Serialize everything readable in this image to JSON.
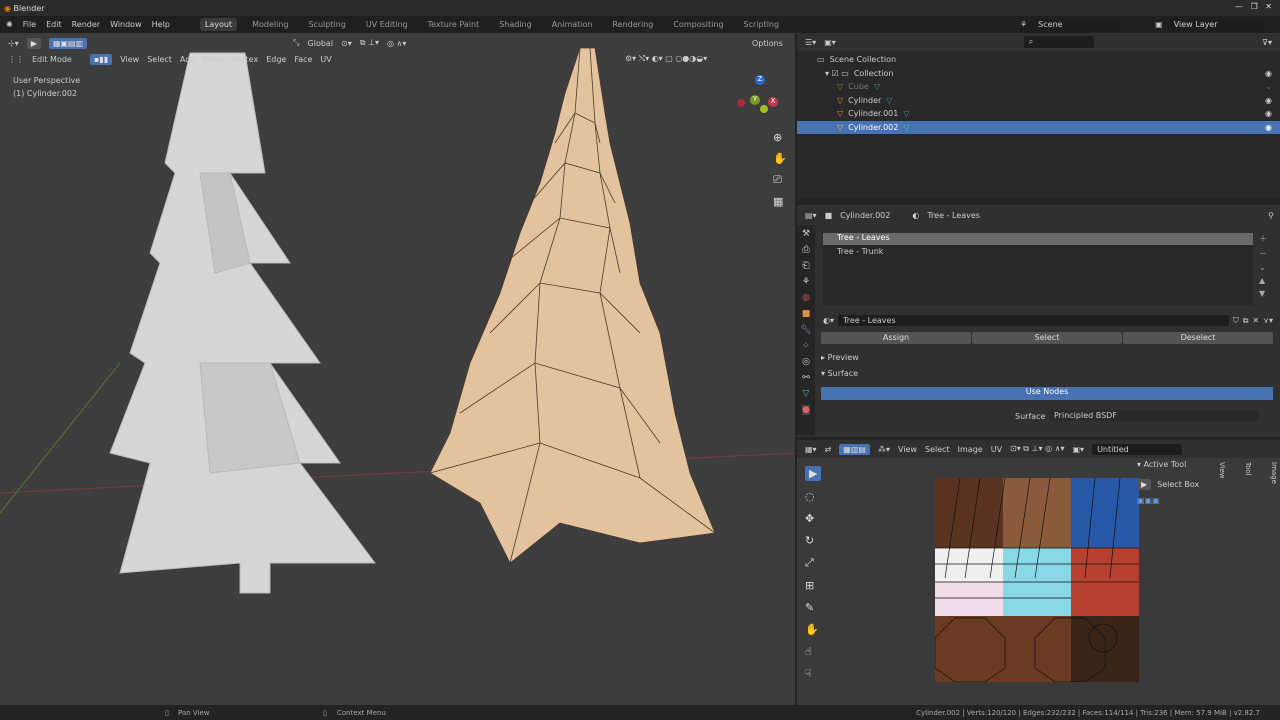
{
  "window": {
    "title": "Blender"
  },
  "menu": [
    "File",
    "Edit",
    "Render",
    "Window",
    "Help"
  ],
  "workspaces": [
    "Layout",
    "Modeling",
    "Sculpting",
    "UV Editing",
    "Texture Paint",
    "Shading",
    "Animation",
    "Rendering",
    "Compositing",
    "Scripting"
  ],
  "scene": {
    "name": "Scene",
    "view_layer": "View Layer"
  },
  "viewport": {
    "orientation": "Global",
    "mode": "Edit Mode",
    "menus": [
      "View",
      "Select",
      "Add",
      "Mesh",
      "Vertex",
      "Edge",
      "Face",
      "UV"
    ],
    "options": "Options",
    "overlay_title": "User Perspective",
    "overlay_object": "(1) Cylinder.002",
    "gizmo_axes": [
      "Z",
      "Y",
      "X"
    ]
  },
  "outliner": {
    "root": "Scene Collection",
    "collection": "Collection",
    "items": [
      {
        "name": "Cube",
        "selected": false,
        "hidden": true
      },
      {
        "name": "Cylinder",
        "selected": false
      },
      {
        "name": "Cylinder.001",
        "selected": false
      },
      {
        "name": "Cylinder.002",
        "selected": true
      }
    ]
  },
  "properties": {
    "object": "Cylinder.002",
    "material": "Tree - Leaves",
    "slots": [
      "Tree - Leaves",
      "Tree - Trunk"
    ],
    "material_field": "Tree - Leaves",
    "assign": "Assign",
    "select": "Select",
    "deselect": "Deselect",
    "preview": "Preview",
    "surface_panel": "Surface",
    "use_nodes": "Use Nodes",
    "surface_label": "Surface",
    "surface_value": "Principled BSDF"
  },
  "uv_editor": {
    "menus": [
      "View",
      "Select",
      "Image",
      "UV"
    ],
    "image": "Untitled",
    "active_tool_title": "Active Tool",
    "active_tool": "Select Box",
    "side_tabs": [
      "Image",
      "Tool",
      "View"
    ]
  },
  "status": {
    "pan": "Pan View",
    "context": "Context Menu",
    "stats": "Cylinder.002 | Verts:120/120 | Edges:232/232 | Faces:114/114 | Tris:236 | Mem: 57.9 MiB | v2.82.7"
  },
  "colors": {
    "accent": "#4772b3",
    "mesh_edit": "#e0c09a",
    "mesh_white": "#d8d8d8"
  }
}
